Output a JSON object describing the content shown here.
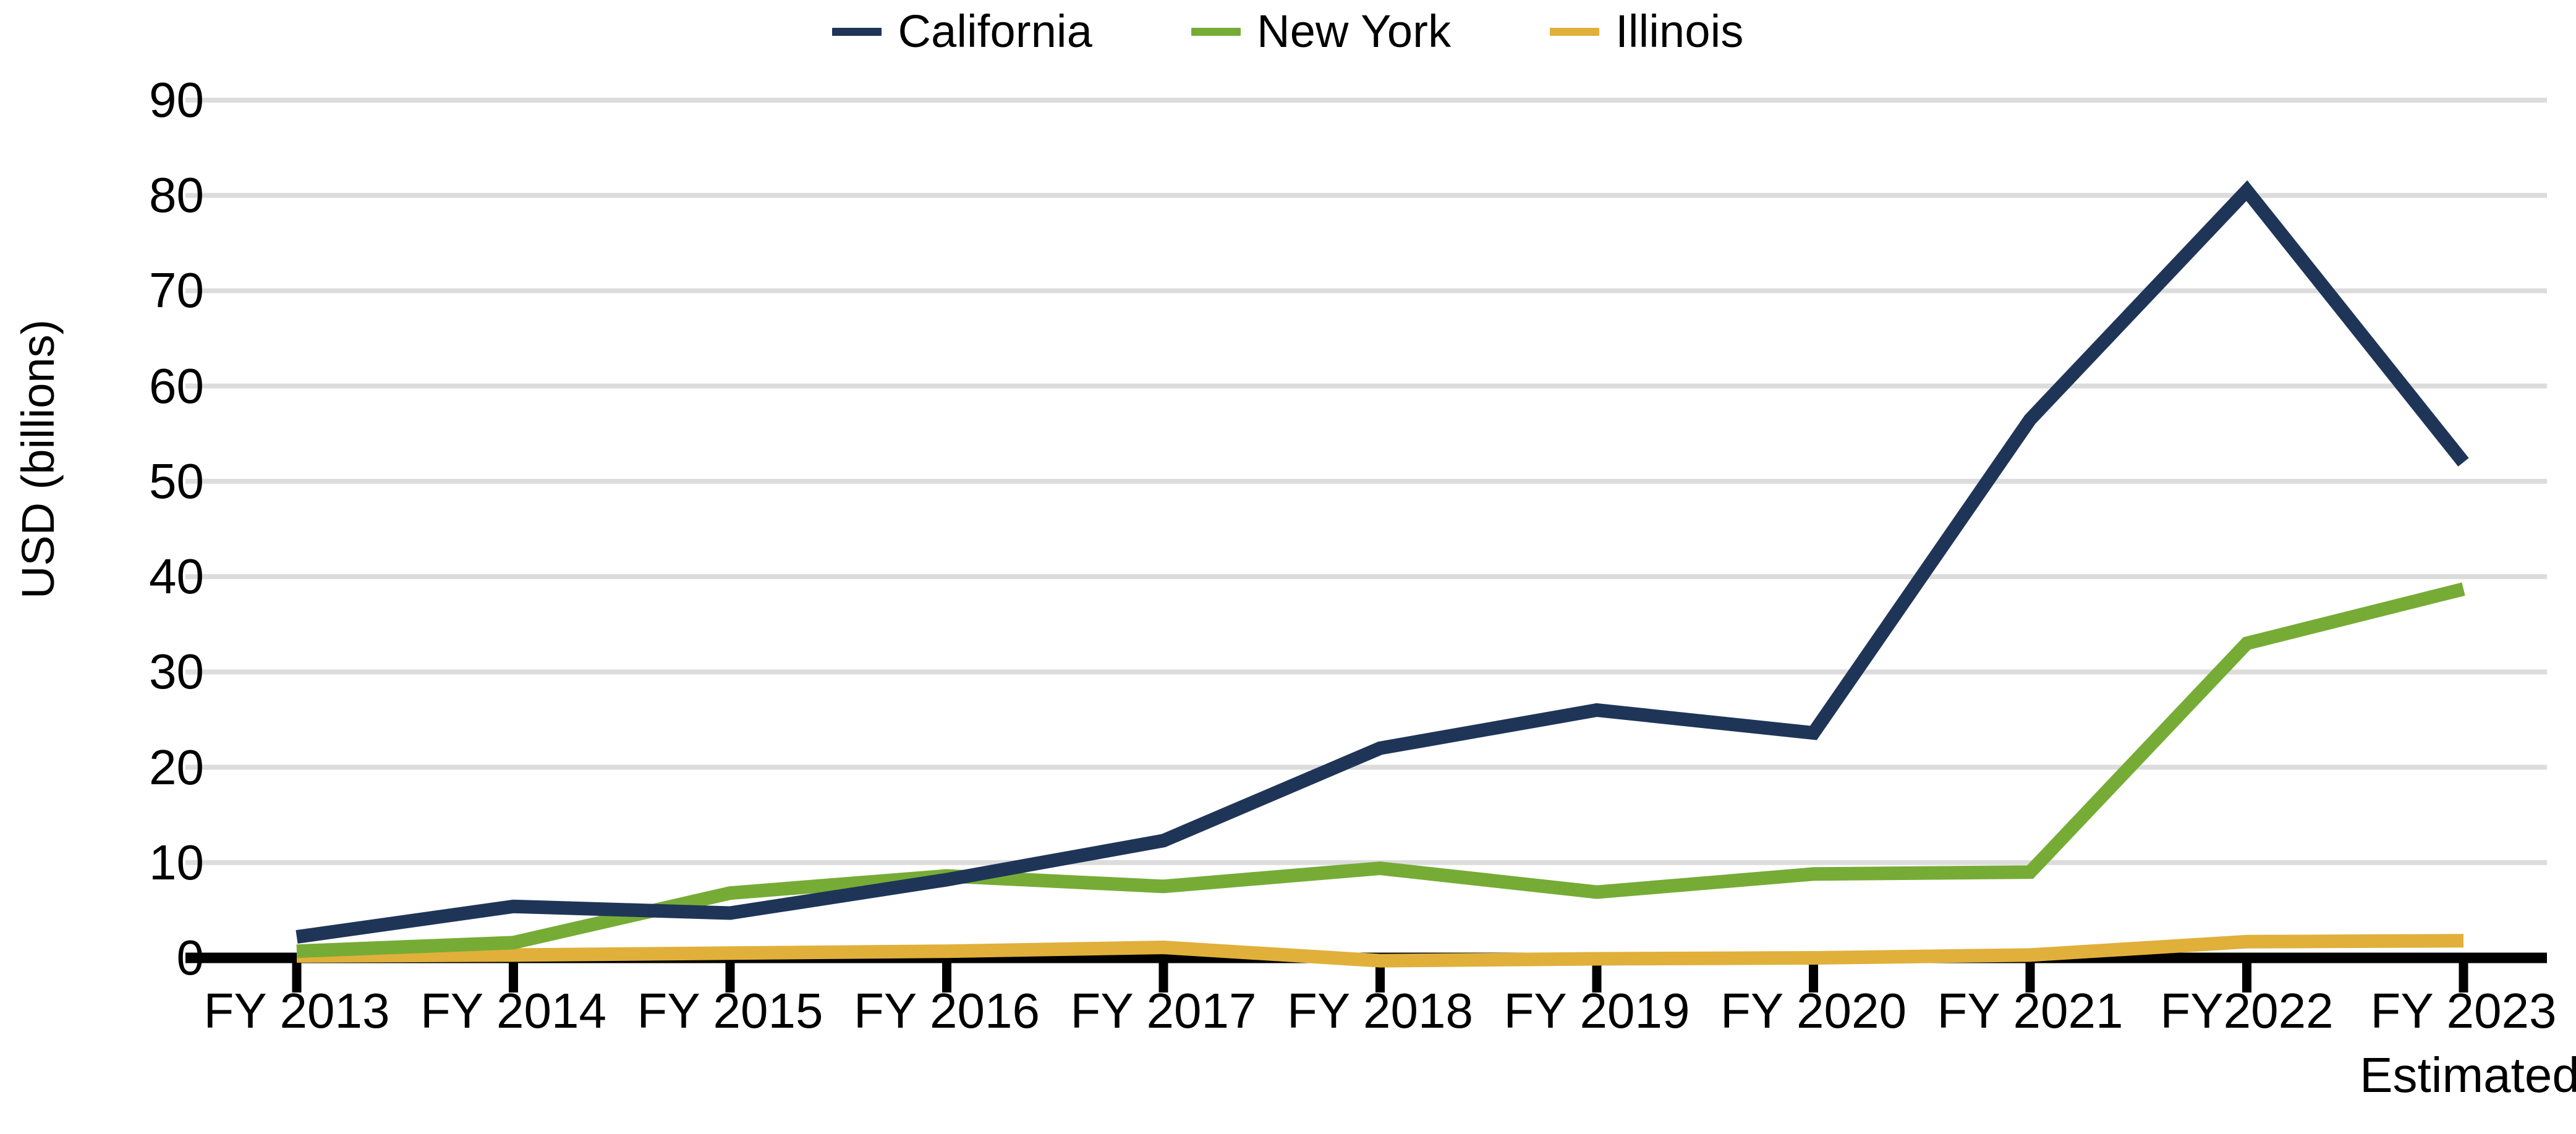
{
  "legend": {
    "position": "top-center",
    "items": [
      {
        "label": "California",
        "color": "#1f3558",
        "swatch": "line-swatch"
      },
      {
        "label": "New York",
        "color": "#76ac36",
        "swatch": "line-swatch"
      },
      {
        "label": "Illinois",
        "color": "#e0b03a",
        "swatch": "line-swatch"
      }
    ]
  },
  "axes": {
    "y_title": "USD (billions)",
    "y_ticks": [
      "90",
      "80",
      "70",
      "60",
      "50",
      "40",
      "30",
      "20",
      "10",
      "0"
    ],
    "x_ticks": [
      "FY 2013",
      "FY 2014",
      "FY 2015",
      "FY 2016",
      "FY 2017",
      "FY 2018",
      "FY 2019",
      "FY 2020",
      "FY 2021",
      "FY2022",
      "FY 2023"
    ],
    "x_note": "Estimated"
  },
  "colors": {
    "california": "#1f3558",
    "new_york": "#76ac36",
    "illinois": "#e0b03a",
    "gridline": "#dcdcdc",
    "axis": "#000000",
    "background": "#ffffff"
  },
  "chart_data": {
    "type": "line",
    "title": "",
    "subtitle": "",
    "xlabel": "",
    "ylabel": "USD (billions)",
    "categories": [
      "FY 2013",
      "FY 2014",
      "FY 2015",
      "FY 2016",
      "FY 2017",
      "FY 2018",
      "FY 2019",
      "FY 2020",
      "FY 2021",
      "FY2022",
      "FY 2023"
    ],
    "x_tick_labels": [
      "FY 2013",
      "FY 2014",
      "FY 2015",
      "FY 2016",
      "FY 2017",
      "FY 2018",
      "FY 2019",
      "FY 2020",
      "FY 2021",
      "FY2022",
      "FY 2023"
    ],
    "y_tick_labels": [
      "0",
      "10",
      "20",
      "30",
      "40",
      "50",
      "60",
      "70",
      "80",
      "90"
    ],
    "ylim": [
      0,
      90
    ],
    "y_step": 10,
    "grid": "horizontal",
    "legend_position": "top-center",
    "annotations": [
      "Estimated (applies to FY 2023)"
    ],
    "series": [
      {
        "name": "California",
        "color": "#1f3558",
        "values": [
          2.2,
          5.4,
          4.7,
          8.2,
          12.3,
          22.0,
          26.0,
          23.6,
          56.5,
          80.5,
          52.0
        ]
      },
      {
        "name": "New York",
        "color": "#76ac36",
        "values": [
          0.7,
          1.6,
          6.8,
          8.6,
          7.5,
          9.4,
          6.9,
          8.8,
          9.0,
          33.0,
          38.7
        ]
      },
      {
        "name": "Illinois",
        "color": "#e0b03a",
        "values": [
          0.2,
          0.3,
          0.5,
          0.7,
          1.1,
          -0.3,
          -0.1,
          0.0,
          0.3,
          1.7,
          1.8
        ]
      }
    ]
  },
  "geometry": {
    "plot_left": 480,
    "plot_right": 3985,
    "y_zero": 1550,
    "y_top": 162,
    "line_width": 22
  }
}
